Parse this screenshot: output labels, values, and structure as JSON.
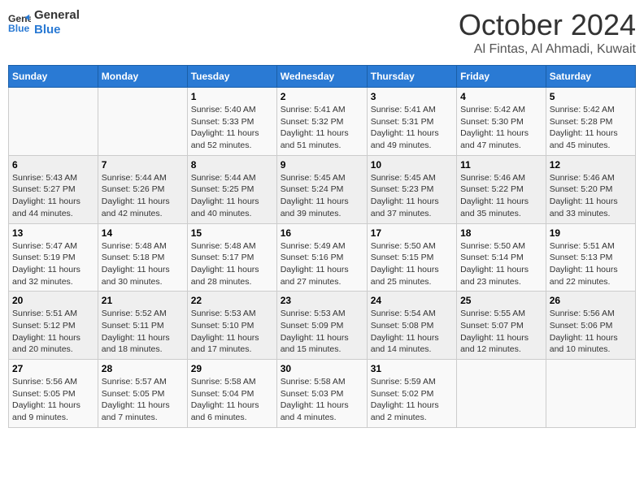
{
  "logo": {
    "line1": "General",
    "line2": "Blue"
  },
  "title": "October 2024",
  "location": "Al Fintas, Al Ahmadi, Kuwait",
  "weekdays": [
    "Sunday",
    "Monday",
    "Tuesday",
    "Wednesday",
    "Thursday",
    "Friday",
    "Saturday"
  ],
  "weeks": [
    [
      {
        "day": "",
        "info": ""
      },
      {
        "day": "",
        "info": ""
      },
      {
        "day": "1",
        "info": "Sunrise: 5:40 AM\nSunset: 5:33 PM\nDaylight: 11 hours and 52 minutes."
      },
      {
        "day": "2",
        "info": "Sunrise: 5:41 AM\nSunset: 5:32 PM\nDaylight: 11 hours and 51 minutes."
      },
      {
        "day": "3",
        "info": "Sunrise: 5:41 AM\nSunset: 5:31 PM\nDaylight: 11 hours and 49 minutes."
      },
      {
        "day": "4",
        "info": "Sunrise: 5:42 AM\nSunset: 5:30 PM\nDaylight: 11 hours and 47 minutes."
      },
      {
        "day": "5",
        "info": "Sunrise: 5:42 AM\nSunset: 5:28 PM\nDaylight: 11 hours and 45 minutes."
      }
    ],
    [
      {
        "day": "6",
        "info": "Sunrise: 5:43 AM\nSunset: 5:27 PM\nDaylight: 11 hours and 44 minutes."
      },
      {
        "day": "7",
        "info": "Sunrise: 5:44 AM\nSunset: 5:26 PM\nDaylight: 11 hours and 42 minutes."
      },
      {
        "day": "8",
        "info": "Sunrise: 5:44 AM\nSunset: 5:25 PM\nDaylight: 11 hours and 40 minutes."
      },
      {
        "day": "9",
        "info": "Sunrise: 5:45 AM\nSunset: 5:24 PM\nDaylight: 11 hours and 39 minutes."
      },
      {
        "day": "10",
        "info": "Sunrise: 5:45 AM\nSunset: 5:23 PM\nDaylight: 11 hours and 37 minutes."
      },
      {
        "day": "11",
        "info": "Sunrise: 5:46 AM\nSunset: 5:22 PM\nDaylight: 11 hours and 35 minutes."
      },
      {
        "day": "12",
        "info": "Sunrise: 5:46 AM\nSunset: 5:20 PM\nDaylight: 11 hours and 33 minutes."
      }
    ],
    [
      {
        "day": "13",
        "info": "Sunrise: 5:47 AM\nSunset: 5:19 PM\nDaylight: 11 hours and 32 minutes."
      },
      {
        "day": "14",
        "info": "Sunrise: 5:48 AM\nSunset: 5:18 PM\nDaylight: 11 hours and 30 minutes."
      },
      {
        "day": "15",
        "info": "Sunrise: 5:48 AM\nSunset: 5:17 PM\nDaylight: 11 hours and 28 minutes."
      },
      {
        "day": "16",
        "info": "Sunrise: 5:49 AM\nSunset: 5:16 PM\nDaylight: 11 hours and 27 minutes."
      },
      {
        "day": "17",
        "info": "Sunrise: 5:50 AM\nSunset: 5:15 PM\nDaylight: 11 hours and 25 minutes."
      },
      {
        "day": "18",
        "info": "Sunrise: 5:50 AM\nSunset: 5:14 PM\nDaylight: 11 hours and 23 minutes."
      },
      {
        "day": "19",
        "info": "Sunrise: 5:51 AM\nSunset: 5:13 PM\nDaylight: 11 hours and 22 minutes."
      }
    ],
    [
      {
        "day": "20",
        "info": "Sunrise: 5:51 AM\nSunset: 5:12 PM\nDaylight: 11 hours and 20 minutes."
      },
      {
        "day": "21",
        "info": "Sunrise: 5:52 AM\nSunset: 5:11 PM\nDaylight: 11 hours and 18 minutes."
      },
      {
        "day": "22",
        "info": "Sunrise: 5:53 AM\nSunset: 5:10 PM\nDaylight: 11 hours and 17 minutes."
      },
      {
        "day": "23",
        "info": "Sunrise: 5:53 AM\nSunset: 5:09 PM\nDaylight: 11 hours and 15 minutes."
      },
      {
        "day": "24",
        "info": "Sunrise: 5:54 AM\nSunset: 5:08 PM\nDaylight: 11 hours and 14 minutes."
      },
      {
        "day": "25",
        "info": "Sunrise: 5:55 AM\nSunset: 5:07 PM\nDaylight: 11 hours and 12 minutes."
      },
      {
        "day": "26",
        "info": "Sunrise: 5:56 AM\nSunset: 5:06 PM\nDaylight: 11 hours and 10 minutes."
      }
    ],
    [
      {
        "day": "27",
        "info": "Sunrise: 5:56 AM\nSunset: 5:05 PM\nDaylight: 11 hours and 9 minutes."
      },
      {
        "day": "28",
        "info": "Sunrise: 5:57 AM\nSunset: 5:05 PM\nDaylight: 11 hours and 7 minutes."
      },
      {
        "day": "29",
        "info": "Sunrise: 5:58 AM\nSunset: 5:04 PM\nDaylight: 11 hours and 6 minutes."
      },
      {
        "day": "30",
        "info": "Sunrise: 5:58 AM\nSunset: 5:03 PM\nDaylight: 11 hours and 4 minutes."
      },
      {
        "day": "31",
        "info": "Sunrise: 5:59 AM\nSunset: 5:02 PM\nDaylight: 11 hours and 2 minutes."
      },
      {
        "day": "",
        "info": ""
      },
      {
        "day": "",
        "info": ""
      }
    ]
  ]
}
